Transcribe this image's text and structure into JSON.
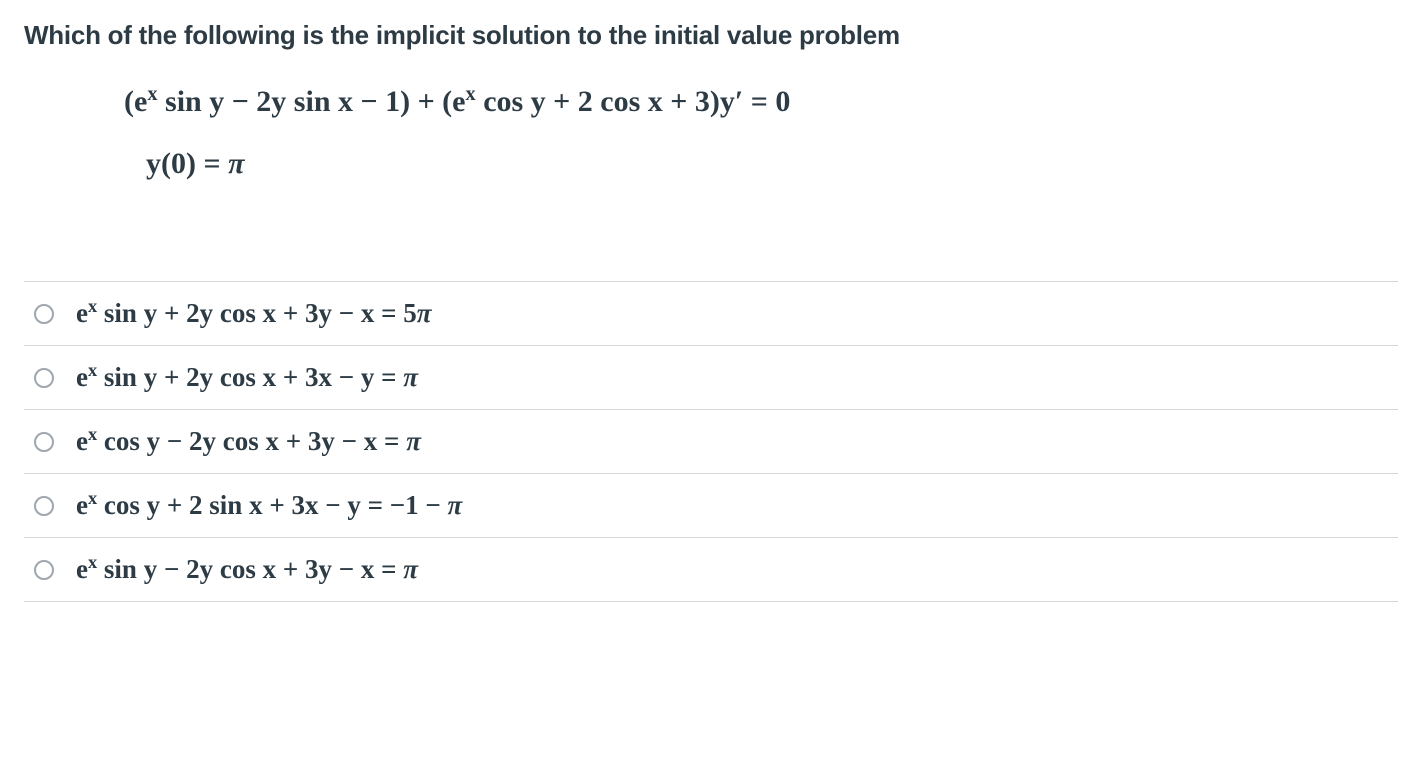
{
  "question": {
    "prompt": "Which of the following is the implicit solution to the initial value problem",
    "equation_html": "(e<sup>x</sup> sin y − 2y sin x − 1) + (e<sup>x</sup> cos y + 2 cos x + 3)y′ = 0",
    "initial_condition_html": "y(0) = <span class='ital'>π</span>"
  },
  "options": [
    {
      "formula_html": "e<sup>x</sup> sin y + 2y cos x + 3y − x = 5<span class='ital'>π</span>"
    },
    {
      "formula_html": "e<sup>x</sup> sin y + 2y cos x + 3x − y = <span class='ital'>π</span>"
    },
    {
      "formula_html": "e<sup>x</sup> cos y − 2y cos x + 3y − x = <span class='ital'>π</span>"
    },
    {
      "formula_html": "e<sup>x</sup> cos y + 2 sin x + 3x − y = −1 − <span class='ital'>π</span>"
    },
    {
      "formula_html": "e<sup>x</sup> sin y − 2y cos x + 3y − x = <span class='ital'>π</span>"
    }
  ]
}
